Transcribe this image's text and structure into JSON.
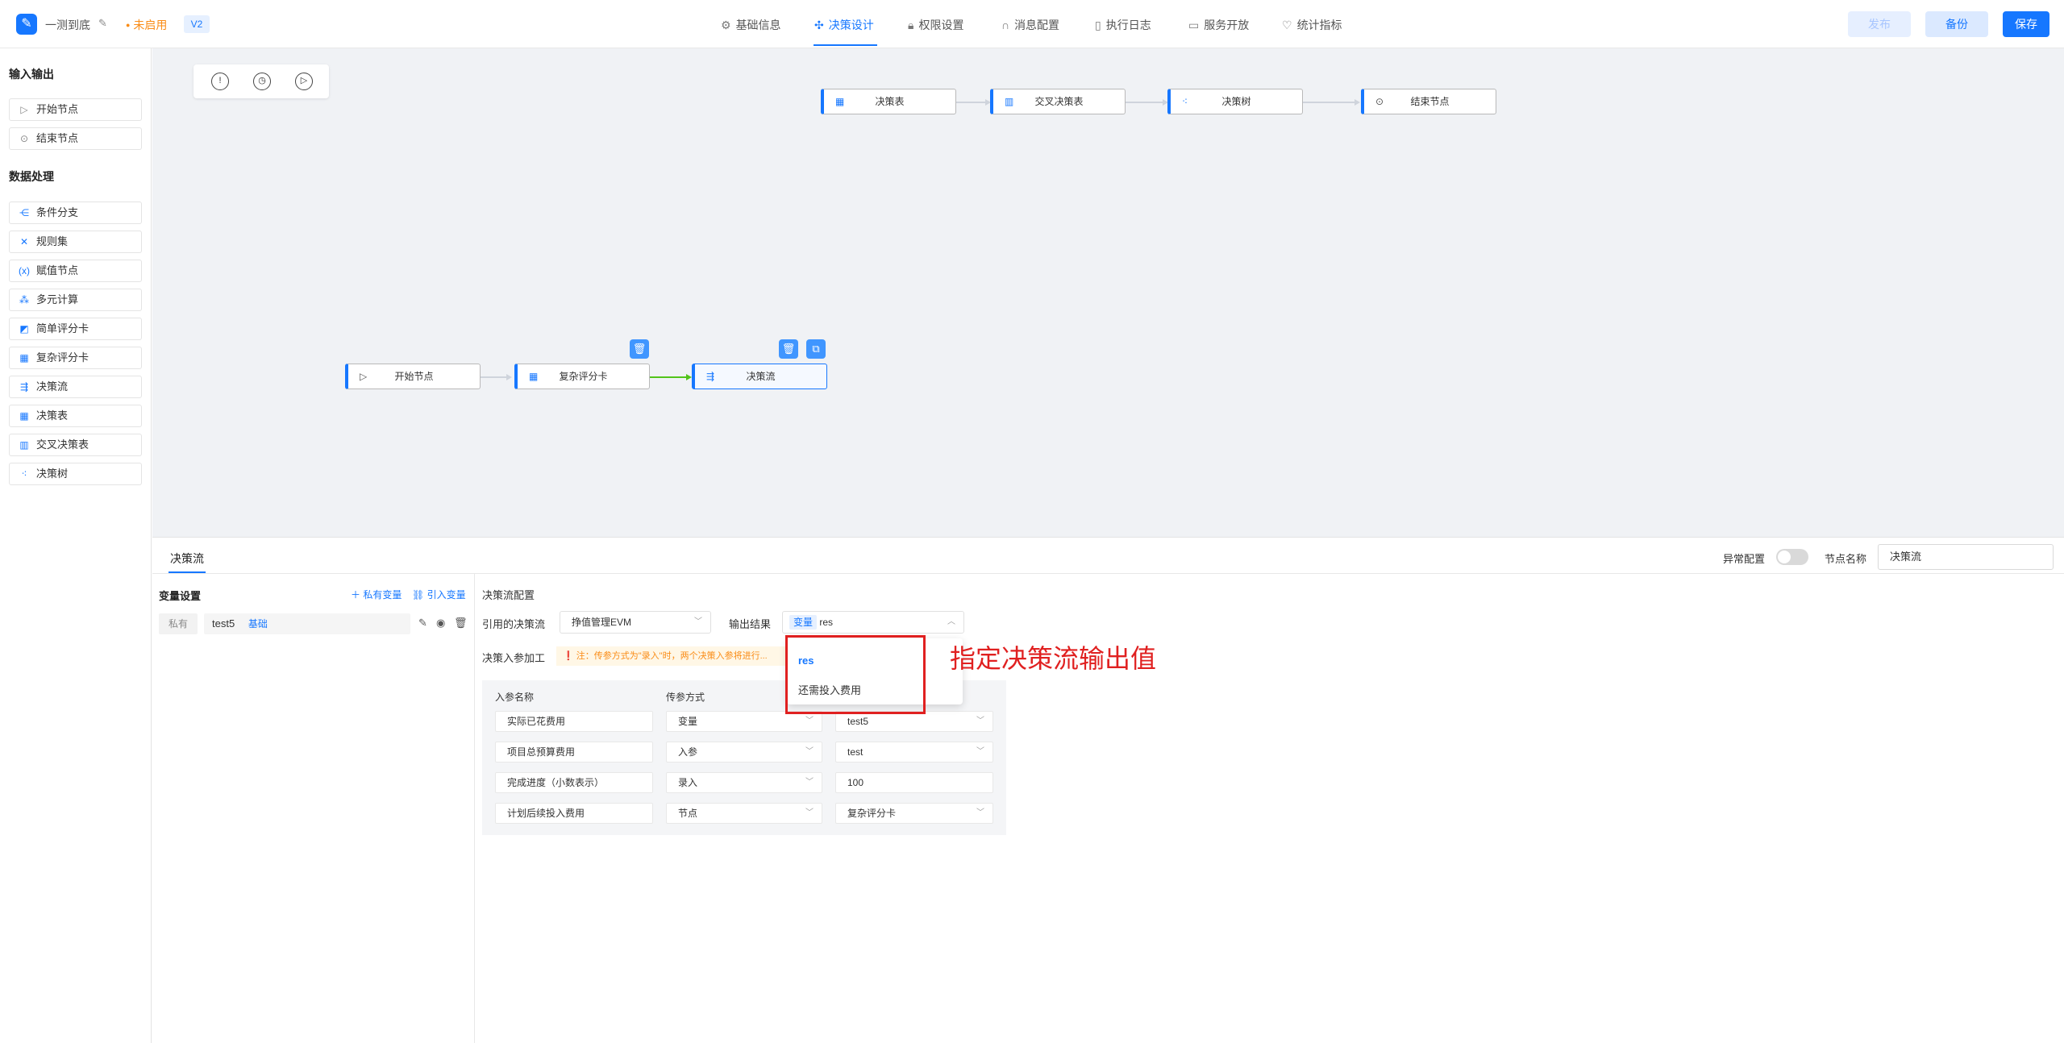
{
  "header": {
    "logo_icon": "app-logo-icon",
    "app_title": "一测到底",
    "status": "未启用",
    "version": "V2",
    "tabs": [
      {
        "label": "基础信息",
        "icon": "gear-icon",
        "active": false
      },
      {
        "label": "决策设计",
        "icon": "design-icon",
        "active": true
      },
      {
        "label": "权限设置",
        "icon": "lock-icon",
        "active": false
      },
      {
        "label": "消息配置",
        "icon": "headset-icon",
        "active": false
      },
      {
        "label": "执行日志",
        "icon": "document-icon",
        "active": false
      },
      {
        "label": "服务开放",
        "icon": "book-icon",
        "active": false
      },
      {
        "label": "统计指标",
        "icon": "chart-icon",
        "active": false
      }
    ],
    "buttons": {
      "publish": "发布",
      "backup": "备份",
      "save": "保存"
    }
  },
  "sidebar": {
    "sections": [
      {
        "title": "输入输出",
        "items": [
          "开始节点",
          "结束节点"
        ]
      },
      {
        "title": "数据处理",
        "items": [
          "条件分支",
          "规则集",
          "赋值节点",
          "多元计算",
          "简单评分卡",
          "复杂评分卡",
          "决策流",
          "决策表",
          "交叉决策表",
          "决策树"
        ]
      }
    ]
  },
  "canvas": {
    "top_flow": [
      "决策表",
      "交叉决策表",
      "决策树",
      "结束节点"
    ],
    "main_flow": [
      "开始节点",
      "复杂评分卡",
      "决策流"
    ]
  },
  "panel": {
    "tab": "决策流",
    "exception_label": "异常配置",
    "node_name_label": "节点名称",
    "node_name_value": "决策流",
    "variables": {
      "title": "变量设置",
      "add_private": "私有变量",
      "import_var": "引入变量",
      "row": {
        "scope": "私有",
        "name": "test5",
        "type": "基础"
      }
    },
    "config": {
      "title": "决策流配置",
      "ref_label": "引用的决策流",
      "ref_value": "挣值管理EVM",
      "output_label": "输出结果",
      "output_tag": "变量",
      "output_value": "res",
      "input_label": "决策入参加工",
      "note": "注：传参方式为\"录入\"时，两个决策入参将进行...",
      "table": {
        "headers": [
          "入参名称",
          "传参方式"
        ],
        "rows": [
          {
            "name": "实际已花费用",
            "mode": "变量",
            "value": "test5"
          },
          {
            "name": "项目总预算费用",
            "mode": "入参",
            "value": "test"
          },
          {
            "name": "完成进度（小数表示）",
            "mode": "录入",
            "value": "100"
          },
          {
            "name": "计划后续投入费用",
            "mode": "节点",
            "value": "复杂评分卡"
          }
        ]
      }
    },
    "dropdown_options": [
      "res",
      "还需投入费用"
    ],
    "annotation": "指定决策流输出值"
  }
}
